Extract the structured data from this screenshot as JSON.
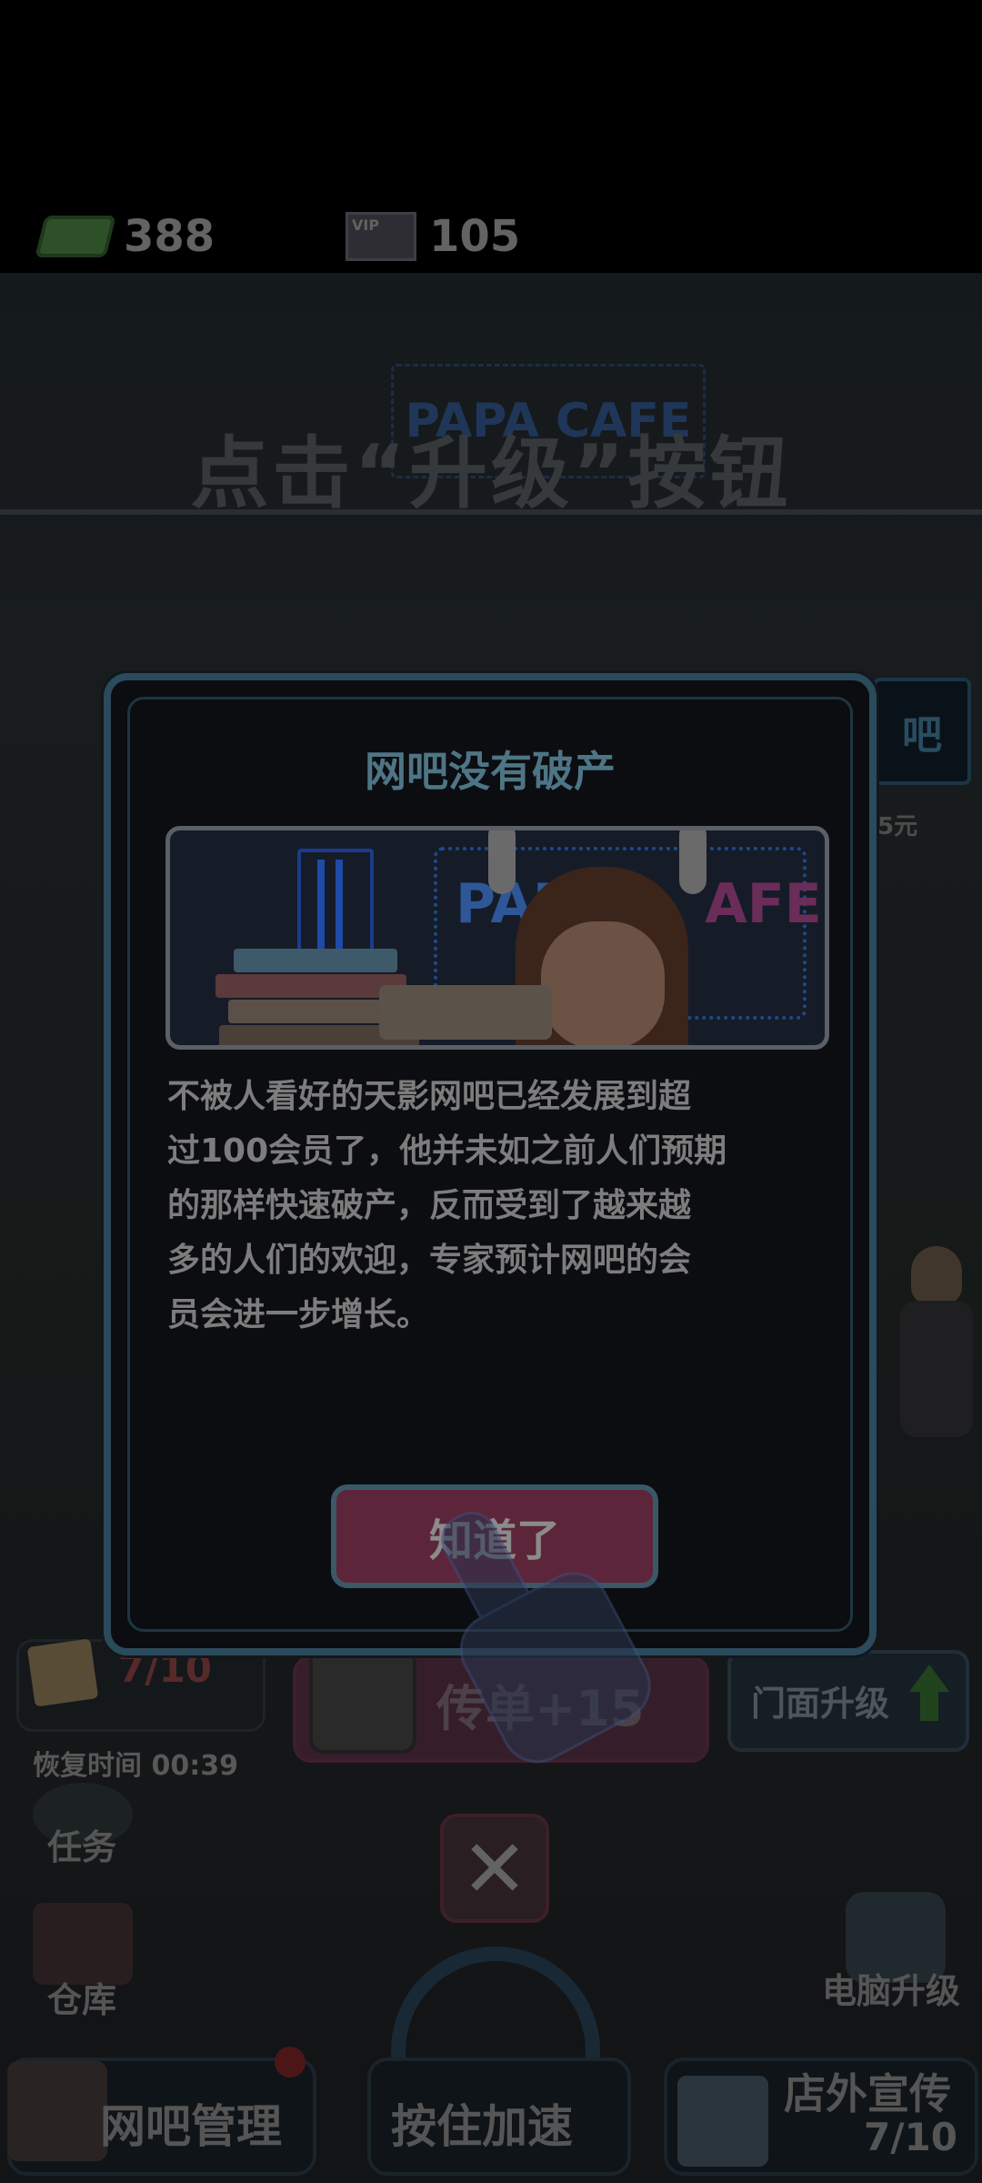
{
  "resources": {
    "cash": "388",
    "vip": "105",
    "vip_tag": "VIP"
  },
  "tutorial_hint": "点击“升级”按钮",
  "background": {
    "papa_sign": "PAPA CAFE",
    "side_sign": "吧",
    "side_price": "5元"
  },
  "modal": {
    "title": "网吧没有破产",
    "banner_sign_left": "PAPA",
    "banner_sign_right": "AFE",
    "story": "不被人看好的天影网吧已经发展到超\n过100会员了，他并未如之前人们预期\n的那样快速破产，反而受到了越来越\n多的人们的欢迎，专家预计网吧的会\n员会进一步增长。",
    "ok_label": "知道了"
  },
  "hud": {
    "flyer_count": "7/10",
    "recover_label": "恢复时间 00:39",
    "promo_label": "传单+15",
    "facade_label": "门面升级",
    "close_symbol": "✕",
    "mission_label": "任务",
    "storage_label": "仓库",
    "pc_upgrade_label": "电脑升级",
    "manage_label": "网吧管理",
    "speed_label": "按住加速",
    "outdoor_label": "店外宣传",
    "outdoor_count": "7/10"
  },
  "colors": {
    "modal_border": "#2b4a5b",
    "ok_button": "#5c2539",
    "title": "#4e7585"
  }
}
